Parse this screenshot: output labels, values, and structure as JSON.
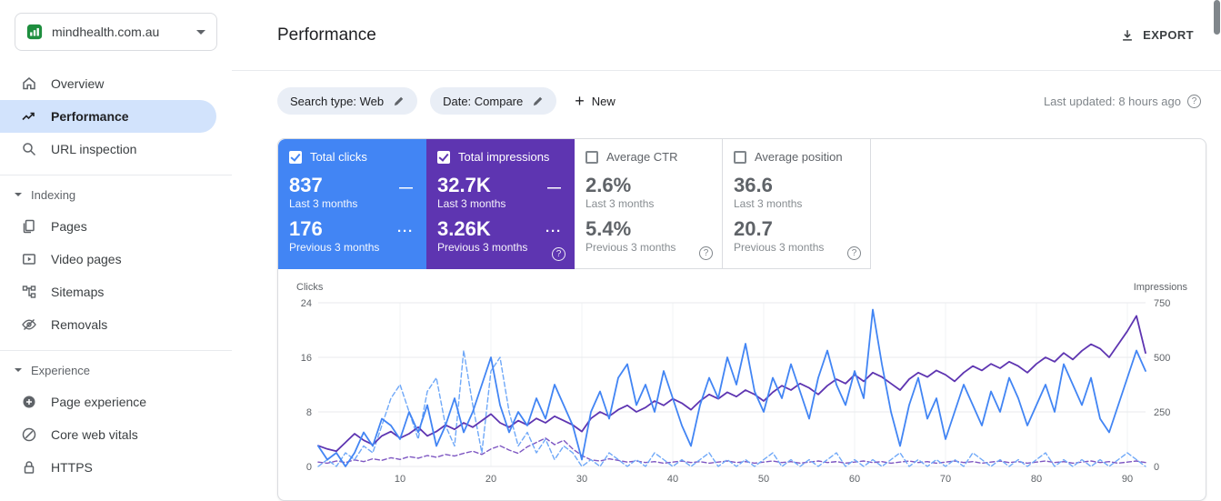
{
  "property_selector": {
    "name": "mindhealth.com.au"
  },
  "sidebar": {
    "top": [
      {
        "label": "Overview"
      },
      {
        "label": "Performance"
      },
      {
        "label": "URL inspection"
      }
    ],
    "sections": [
      {
        "label": "Indexing",
        "items": [
          "Pages",
          "Video pages",
          "Sitemaps",
          "Removals"
        ]
      },
      {
        "label": "Experience",
        "items": [
          "Page experience",
          "Core web vitals",
          "HTTPS"
        ]
      }
    ]
  },
  "header": {
    "title": "Performance",
    "export_label": "EXPORT"
  },
  "filters": {
    "chips": [
      {
        "label": "Search type: Web"
      },
      {
        "label": "Date: Compare"
      }
    ],
    "new_label": "New",
    "last_updated": "Last updated: 8 hours ago"
  },
  "icons": {
    "help": "?",
    "plus": "+",
    "legend_solid": "—",
    "legend_dotted": "···"
  },
  "metrics": {
    "cards": [
      {
        "label": "Total clicks",
        "checked": true,
        "color": "#4285f4",
        "value1": "837",
        "caption1": "Last 3 months",
        "value2": "176",
        "caption2": "Previous 3 months"
      },
      {
        "label": "Total impressions",
        "checked": true,
        "color": "#5e35b1",
        "value1": "32.7K",
        "caption1": "Last 3 months",
        "value2": "3.26K",
        "caption2": "Previous 3 months"
      },
      {
        "label": "Average CTR",
        "checked": false,
        "value1": "2.6%",
        "caption1": "Last 3 months",
        "value2": "5.4%",
        "caption2": "Previous 3 months"
      },
      {
        "label": "Average position",
        "checked": false,
        "value1": "36.6",
        "caption1": "Last 3 months",
        "value2": "20.7",
        "caption2": "Previous 3 months"
      }
    ]
  },
  "chart_data": {
    "type": "line",
    "x_unit": "day",
    "x_range": [
      1,
      92
    ],
    "x_ticks": [
      10,
      20,
      30,
      40,
      50,
      60,
      70,
      80,
      90
    ],
    "axes": {
      "left": {
        "label": "Clicks",
        "ticks": [
          0,
          8,
          16,
          24
        ],
        "max": 24
      },
      "right": {
        "label": "Impressions",
        "ticks": [
          0,
          250,
          500,
          750
        ],
        "max": 750
      }
    },
    "grid": true,
    "legend_position": "none",
    "series": [
      {
        "name": "Clicks - Last 3 months",
        "axis": "left",
        "style": "solid",
        "color": "#4285f4",
        "values": [
          3,
          1,
          2,
          0,
          2,
          5,
          3,
          7,
          6,
          4,
          8,
          5,
          9,
          3,
          6,
          10,
          5,
          8,
          12,
          16,
          9,
          5,
          8,
          6,
          10,
          7,
          12,
          9,
          6,
          1,
          8,
          11,
          7,
          13,
          15,
          9,
          12,
          8,
          14,
          10,
          6,
          3,
          9,
          13,
          10,
          16,
          12,
          18,
          11,
          8,
          13,
          10,
          15,
          11,
          7,
          13,
          17,
          12,
          9,
          14,
          10,
          23,
          15,
          8,
          3,
          9,
          13,
          7,
          10,
          4,
          8,
          12,
          9,
          6,
          11,
          8,
          13,
          10,
          6,
          9,
          12,
          8,
          15,
          12,
          9,
          13,
          7,
          5,
          9,
          13,
          17,
          14
        ]
      },
      {
        "name": "Clicks - Previous 3 months",
        "axis": "left",
        "style": "dashed",
        "color": "#6fa8f8",
        "values": [
          0,
          1,
          0,
          2,
          1,
          3,
          2,
          6,
          10,
          12,
          8,
          4,
          11,
          13,
          6,
          3,
          17,
          9,
          2,
          14,
          16,
          8,
          3,
          5,
          2,
          4,
          1,
          3,
          2,
          0,
          1,
          0,
          2,
          1,
          0,
          1,
          0,
          2,
          1,
          0,
          1,
          0,
          1,
          2,
          0,
          1,
          0,
          1,
          0,
          1,
          2,
          0,
          1,
          0,
          1,
          0,
          1,
          2,
          0,
          1,
          0,
          1,
          0,
          1,
          2,
          0,
          1,
          0,
          1,
          0,
          1,
          0,
          2,
          1,
          0,
          1,
          0,
          1,
          0,
          1,
          2,
          0,
          1,
          0,
          1,
          0,
          1,
          0,
          1,
          2,
          1,
          0
        ]
      },
      {
        "name": "Impressions - Last 3 months",
        "axis": "right",
        "style": "solid",
        "color": "#5e35b1",
        "values": [
          95,
          80,
          70,
          110,
          150,
          120,
          100,
          140,
          160,
          130,
          150,
          180,
          140,
          160,
          190,
          170,
          200,
          180,
          210,
          240,
          200,
          180,
          210,
          190,
          220,
          200,
          230,
          210,
          190,
          160,
          220,
          250,
          230,
          260,
          280,
          250,
          270,
          300,
          280,
          310,
          290,
          260,
          300,
          330,
          310,
          340,
          320,
          350,
          330,
          300,
          340,
          370,
          350,
          380,
          360,
          330,
          370,
          400,
          380,
          420,
          390,
          430,
          410,
          380,
          350,
          400,
          430,
          410,
          440,
          420,
          390,
          430,
          460,
          440,
          470,
          450,
          480,
          460,
          430,
          470,
          500,
          480,
          520,
          490,
          530,
          560,
          540,
          500,
          560,
          620,
          690,
          520
        ]
      },
      {
        "name": "Impressions - Previous 3 months",
        "axis": "right",
        "style": "dashed",
        "color": "#7e57c2",
        "values": [
          20,
          15,
          25,
          18,
          30,
          22,
          35,
          28,
          40,
          32,
          45,
          38,
          50,
          42,
          55,
          48,
          60,
          70,
          55,
          80,
          95,
          75,
          60,
          90,
          110,
          130,
          100,
          120,
          80,
          50,
          30,
          25,
          35,
          28,
          20,
          25,
          18,
          22,
          15,
          20,
          25,
          18,
          22,
          15,
          20,
          25,
          18,
          22,
          15,
          20,
          25,
          18,
          22,
          15,
          20,
          25,
          18,
          22,
          15,
          20,
          25,
          18,
          22,
          15,
          20,
          25,
          18,
          22,
          15,
          20,
          25,
          18,
          22,
          15,
          20,
          25,
          18,
          22,
          15,
          20,
          25,
          18,
          22,
          15,
          20,
          25,
          18,
          22,
          15,
          20,
          25,
          18
        ]
      }
    ]
  }
}
